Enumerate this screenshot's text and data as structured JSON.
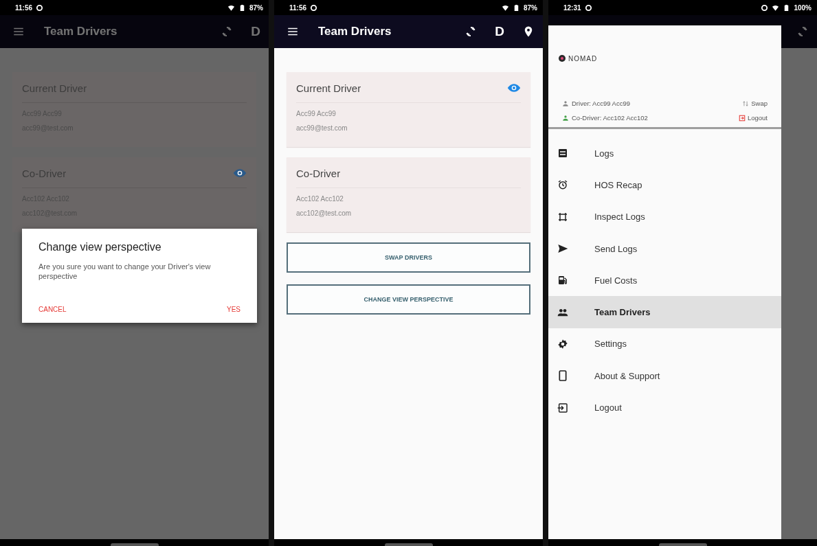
{
  "screens": [
    {
      "kind": "dialog",
      "status_bar": {
        "time": "11:56",
        "battery": "87%"
      },
      "app_bar": {
        "title": "Team Drivers",
        "actions": [
          {
            "kind": "sync"
          },
          {
            "kind": "text",
            "label": "D"
          }
        ]
      },
      "cards": [
        {
          "title": "Current Driver",
          "name": "Acc99 Acc99",
          "email": "acc99@test.com",
          "viewing": false
        },
        {
          "title": "Co-Driver",
          "name": "Acc102 Acc102",
          "email": "acc102@test.com",
          "viewing": true
        }
      ],
      "dialog": {
        "title": "Change view perspective",
        "message": "Are you sure you want to change your Driver's view perspective",
        "cancel": "CANCEL",
        "confirm": "YES"
      }
    },
    {
      "kind": "main",
      "status_bar": {
        "time": "11:56",
        "battery": "87%"
      },
      "app_bar": {
        "title": "Team Drivers",
        "actions": [
          {
            "kind": "sync"
          },
          {
            "kind": "text",
            "label": "D"
          },
          {
            "kind": "pin"
          }
        ]
      },
      "cards": [
        {
          "title": "Current Driver",
          "name": "Acc99 Acc99",
          "email": "acc99@test.com",
          "viewing": true
        },
        {
          "title": "Co-Driver",
          "name": "Acc102 Acc102",
          "email": "acc102@test.com",
          "viewing": false
        }
      ],
      "buttons": [
        "SWAP DRIVERS",
        "CHANGE VIEW PERSPECTIVE"
      ]
    },
    {
      "kind": "drawer",
      "status_bar": {
        "time": "12:31",
        "battery": "100%"
      },
      "drawer": {
        "logo": "NOMAD",
        "driver": "Driver: Acc99 Acc99",
        "co_driver": "Co-Driver: Acc102 Acc102",
        "swap": "Swap",
        "logout": "Logout",
        "items": [
          {
            "kind": "logs",
            "label": "Logs",
            "selected": false
          },
          {
            "kind": "alarm",
            "label": "HOS Recap",
            "selected": false
          },
          {
            "kind": "inspect",
            "label": "Inspect Logs",
            "selected": false
          },
          {
            "kind": "send",
            "label": "Send Logs",
            "selected": false
          },
          {
            "kind": "fuel",
            "label": "Fuel Costs",
            "selected": false
          },
          {
            "kind": "group",
            "label": "Team Drivers",
            "selected": true
          },
          {
            "kind": "gear",
            "label": "Settings",
            "selected": false
          },
          {
            "kind": "phone",
            "label": "About & Support",
            "selected": false
          },
          {
            "kind": "exit",
            "label": "Logout",
            "selected": false
          }
        ]
      }
    }
  ]
}
